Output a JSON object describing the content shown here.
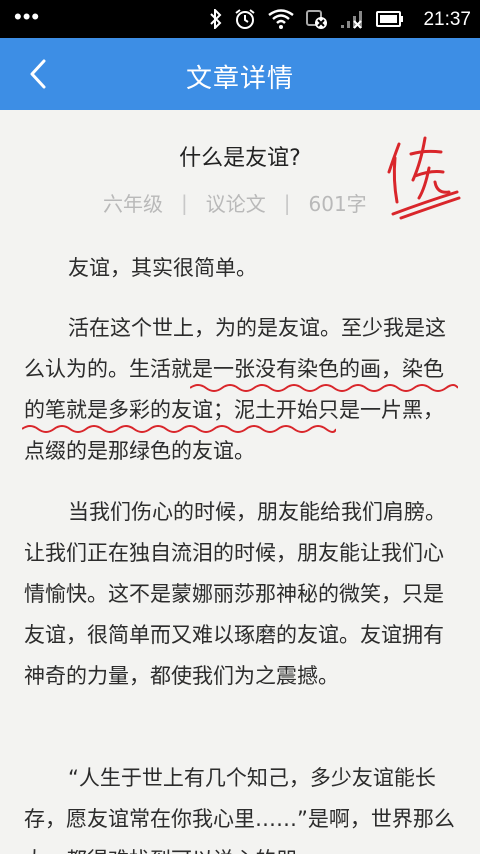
{
  "status_bar": {
    "time": "21:37",
    "icons": [
      "bluetooth-icon",
      "alarm-icon",
      "wifi-icon",
      "data-off-icon",
      "signal-icon",
      "battery-icon"
    ]
  },
  "app_bar": {
    "title": "文章详情"
  },
  "article": {
    "title": "什么是友谊?",
    "grade": "六年级",
    "genre": "议论文",
    "word_count": "601字",
    "stamp_text": "优",
    "paragraphs": [
      {
        "text": "友谊，其实很简单。"
      },
      {
        "parts": [
          "活在这个世上，为的是友谊。至少我是这么认为的。",
          "生活就是一张没有染色的画，染色的笔就是多彩的友谊",
          "；泥土开始只是一片黑，点缀的是那绿色的友谊。"
        ]
      },
      {
        "text": "当我们伤心的时候，朋友能给我们肩膀。让我们正在独自流泪的时候，朋友能让我们心情愉快。这不是蒙娜丽莎那神秘的微笑，只是友谊，很简单而又难以琢磨的友谊。友谊拥有神奇的力量，都使我们为之震撼。"
      },
      {
        "text": "“人生于世上有几个知己，多少友谊能长存，愿友谊常在你我心里……”是啊，世界那么大，都得难找到可以说心的朋"
      }
    ]
  },
  "colors": {
    "status_bar_bg": "#000000",
    "app_bar_bg": "#3d8ee5",
    "page_bg": "#f3f3f1",
    "meta_text": "#b9b9b9",
    "correction_red": "#d9262b"
  }
}
